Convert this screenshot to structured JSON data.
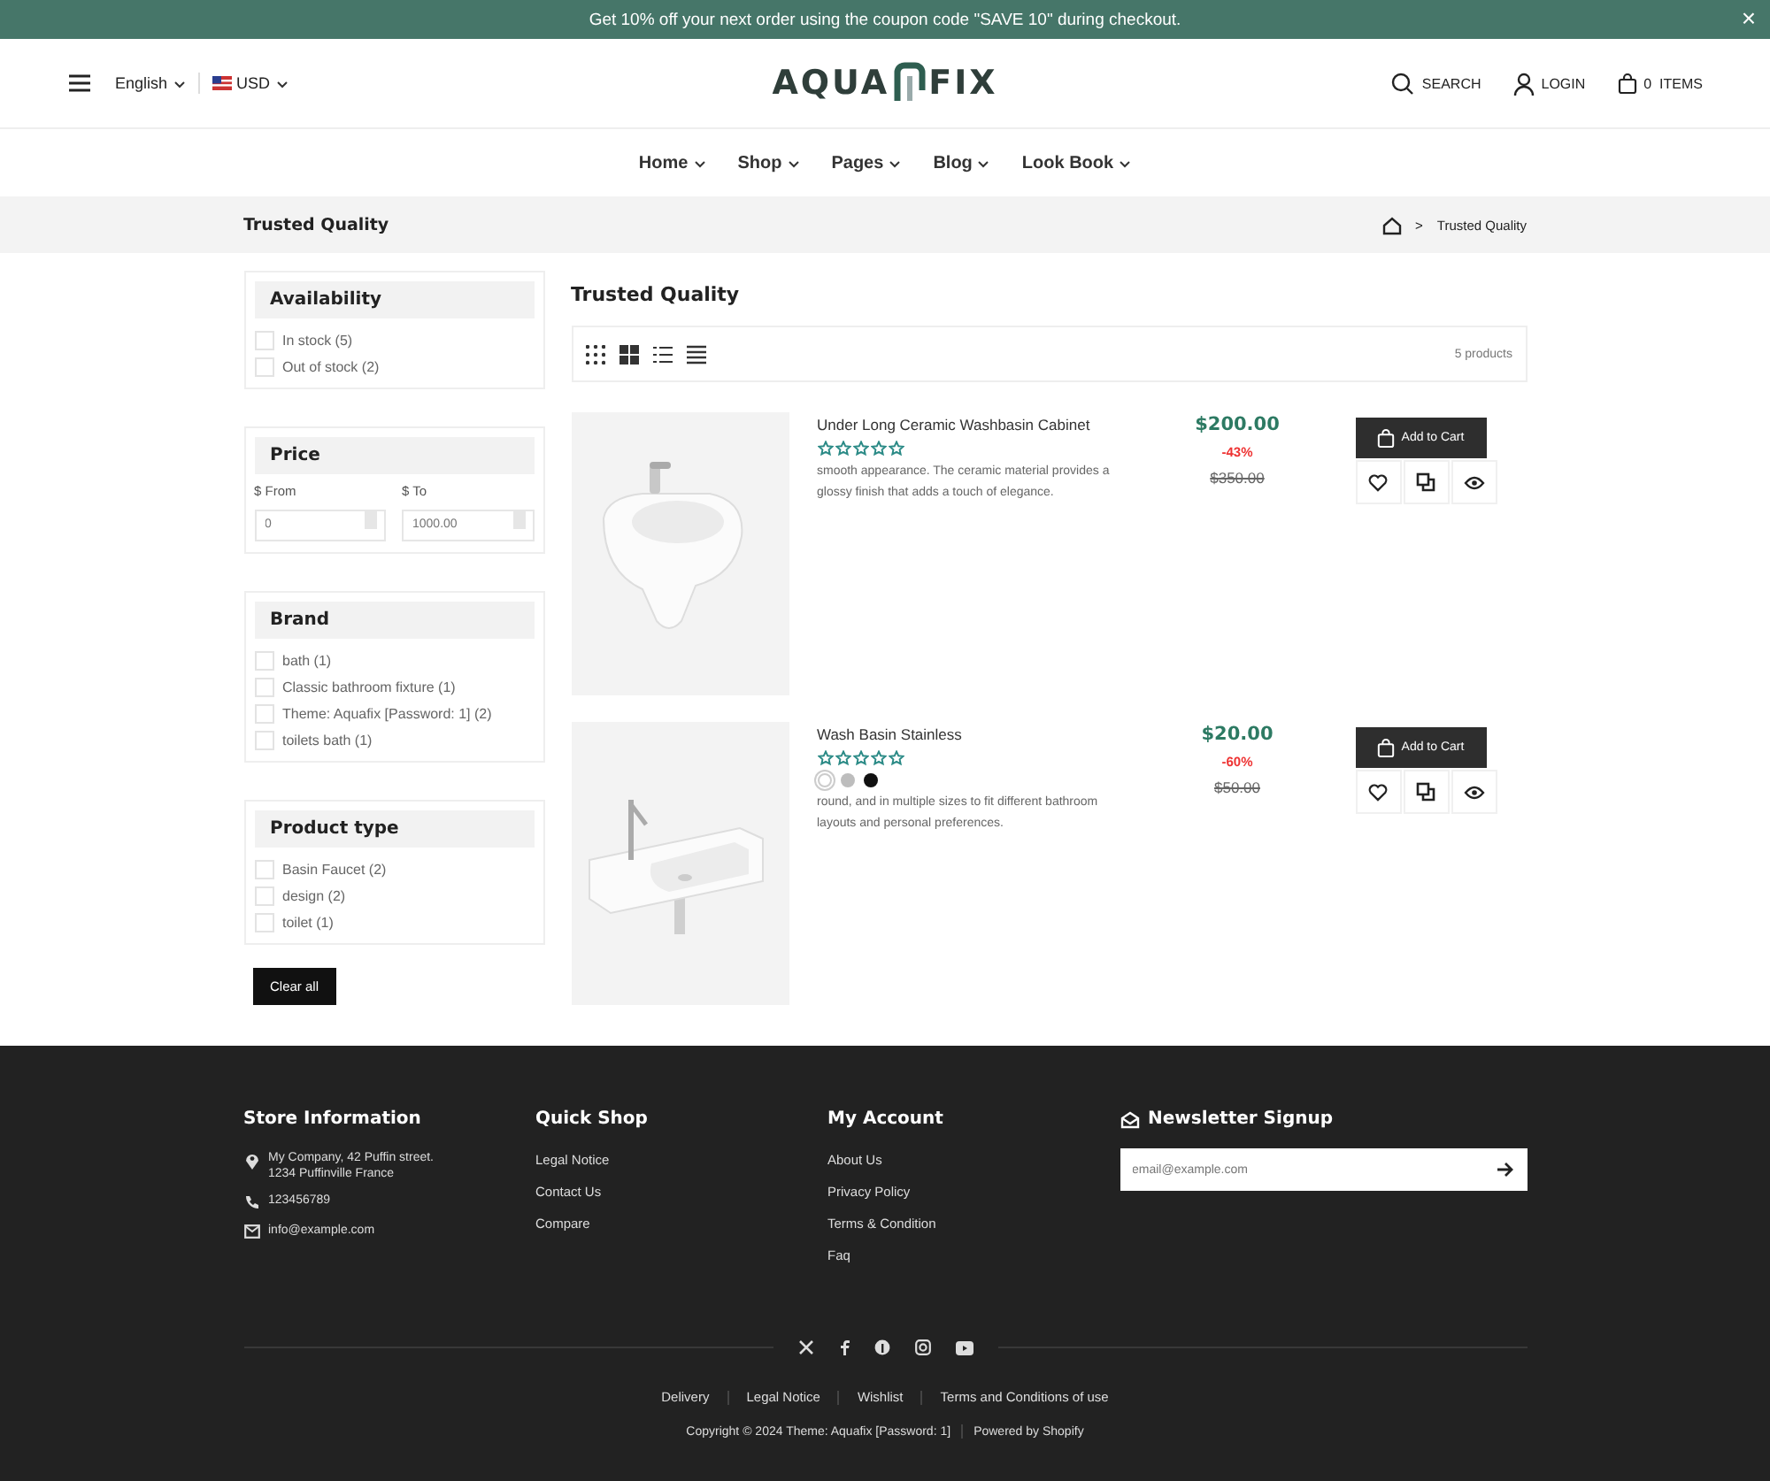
{
  "announcement": {
    "text": "Get 10% off your next order using the coupon code \"SAVE 10\" during checkout.",
    "close": "×"
  },
  "header": {
    "language": "English",
    "currency": "USD",
    "logo_left": "AQUA",
    "logo_right": "FIX",
    "search": "SEARCH",
    "login": "LOGIN",
    "cart_count": "0",
    "cart_label": "ITEMS"
  },
  "nav": [
    "Home",
    "Shop",
    "Pages",
    "Blog",
    "Look Book"
  ],
  "breadcrumb": {
    "title": "Trusted Quality",
    "separator": ">",
    "current": "Trusted Quality"
  },
  "filters": [
    {
      "kind": "checklist",
      "title": "Availability",
      "options": [
        {
          "label": "In stock (5)",
          "checked": false
        },
        {
          "label": "Out of stock (2)",
          "checked": false
        }
      ]
    },
    {
      "kind": "price",
      "title": "Price",
      "from_label": "$ From",
      "from_placeholder": "0",
      "to_label": "$ To",
      "to_placeholder": "1000.00"
    },
    {
      "kind": "checklist",
      "title": "Brand",
      "options": [
        {
          "label": "bath (1)",
          "checked": false
        },
        {
          "label": "Classic bathroom fixture (1)",
          "checked": false
        },
        {
          "label": "Theme: Aquafix [Password: 1] (2)",
          "checked": false
        },
        {
          "label": "toilets bath (1)",
          "checked": false
        }
      ]
    },
    {
      "kind": "checklist",
      "title": "Product type",
      "options": [
        {
          "label": "Basin Faucet (2)",
          "checked": false
        },
        {
          "label": "design (2)",
          "checked": false
        },
        {
          "label": "toilet (1)",
          "checked": false
        }
      ]
    }
  ],
  "clear_all": "Clear all",
  "collection": {
    "title": "Trusted Quality",
    "count": "5 products"
  },
  "products": [
    {
      "kind": "bidet",
      "name": "Under Long Ceramic Washbasin Cabinet",
      "stars": 0,
      "description": "smooth appearance. The ceramic material provides a glossy finish that adds a touch of elegance.",
      "price": "$200.00",
      "discount": "-43%",
      "compare_price": "$350.00",
      "button": "Add to Cart"
    },
    {
      "kind": "basin",
      "name": "Wash Basin Stainless",
      "stars": 0,
      "description": "round, and in multiple sizes to fit different bathroom layouts and personal preferences.",
      "price": "$20.00",
      "discount": "-60%",
      "compare_price": "$50.00",
      "button": "Add to Cart",
      "swatches": [
        {
          "color": "#ffffff",
          "selected": true
        },
        {
          "color": "#bdbdbd",
          "selected": false
        },
        {
          "color": "#111111",
          "selected": false
        }
      ]
    }
  ],
  "footer": {
    "store": {
      "title": "Store Information",
      "address": [
        "My Company, 42 Puffin street.",
        "1234 Puffinville France"
      ],
      "phone": "123456789",
      "email": "info@example.com"
    },
    "quick_shop": {
      "title": "Quick Shop",
      "links": [
        "Legal Notice",
        "Contact Us",
        "Compare"
      ]
    },
    "account": {
      "title": "My Account",
      "links": [
        "About Us",
        "Privacy Policy",
        "Terms & Condition",
        "Faq"
      ]
    },
    "newsletter": {
      "title": "Newsletter Signup",
      "placeholder": "email@example.com"
    },
    "bottom_links": [
      "Delivery",
      "Legal Notice",
      "Wishlist",
      "Terms and Conditions of use"
    ],
    "copyright": "Copyright © 2024 Theme: Aquafix [Password: 1]",
    "powered": "Powered by Shopify"
  }
}
